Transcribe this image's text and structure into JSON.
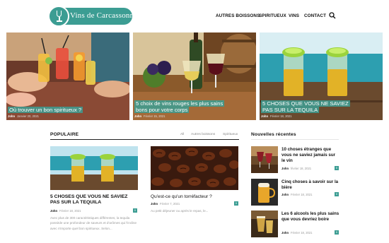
{
  "site": {
    "name": "Vins de Carcassonne"
  },
  "nav": {
    "items": [
      "AUTRES BOISSONS",
      "SPIRITUEUX",
      "VINS",
      "CONTACT"
    ]
  },
  "hero": [
    {
      "title": "Où trouver un bon spiritueux ?",
      "author": "John",
      "date": "Janvier 20, 2021"
    },
    {
      "title": "5 choix de vins rouges les plus sains bons pour votre corps",
      "author": "John",
      "date": "Février 15, 2021"
    },
    {
      "title": "5 CHOSES QUE VOUS NE SAVIEZ PAS SUR LA TEQUILA",
      "author": "John",
      "date": "Février 18, 2021"
    }
  ],
  "popular": {
    "heading": "POPULAIRE",
    "filters": [
      "All",
      "Autres boissons",
      "Spiritueux"
    ],
    "articles": [
      {
        "title": "5 CHOSES QUE VOUS NE SAVIEZ PAS SUR LA TEQUILA",
        "author": "John",
        "date": "Février 18, 2021",
        "count": "0",
        "excerpt": "Avec plus de 300 caractéristiques différentes, la tequila possède une profondeur de saveurs et d'arômes qui l'inclise avec n'importe quel bon spiritueux. Selon..."
      },
      {
        "title": "Qu'est-ce qu'un torréfacteur ?",
        "author": "John",
        "date": "Février 7, 2021",
        "count": "0",
        "excerpt": "Au petit déjeuner ou après le repas, le..."
      }
    ]
  },
  "recent": {
    "heading": "Nouvelles récentes",
    "items": [
      {
        "title": "10 choses étranges que vous ne saviez jamais sur le vin",
        "author": "John",
        "date": "février 18, 2021",
        "count": "0"
      },
      {
        "title": "Cinq choses à savoir sur la bière",
        "author": "John",
        "date": "Février 18, 2021",
        "count": "0"
      },
      {
        "title": "Les 6 alcools les plus sains que vous devriez boire",
        "author": "John",
        "date": "Février 18, 2021",
        "count": "0"
      }
    ]
  },
  "colors": {
    "accent": "#3c9d93",
    "text": "#111111",
    "muted": "#999999"
  },
  "icons": {
    "search": "search-icon",
    "logo": "wine-glass-icon"
  }
}
